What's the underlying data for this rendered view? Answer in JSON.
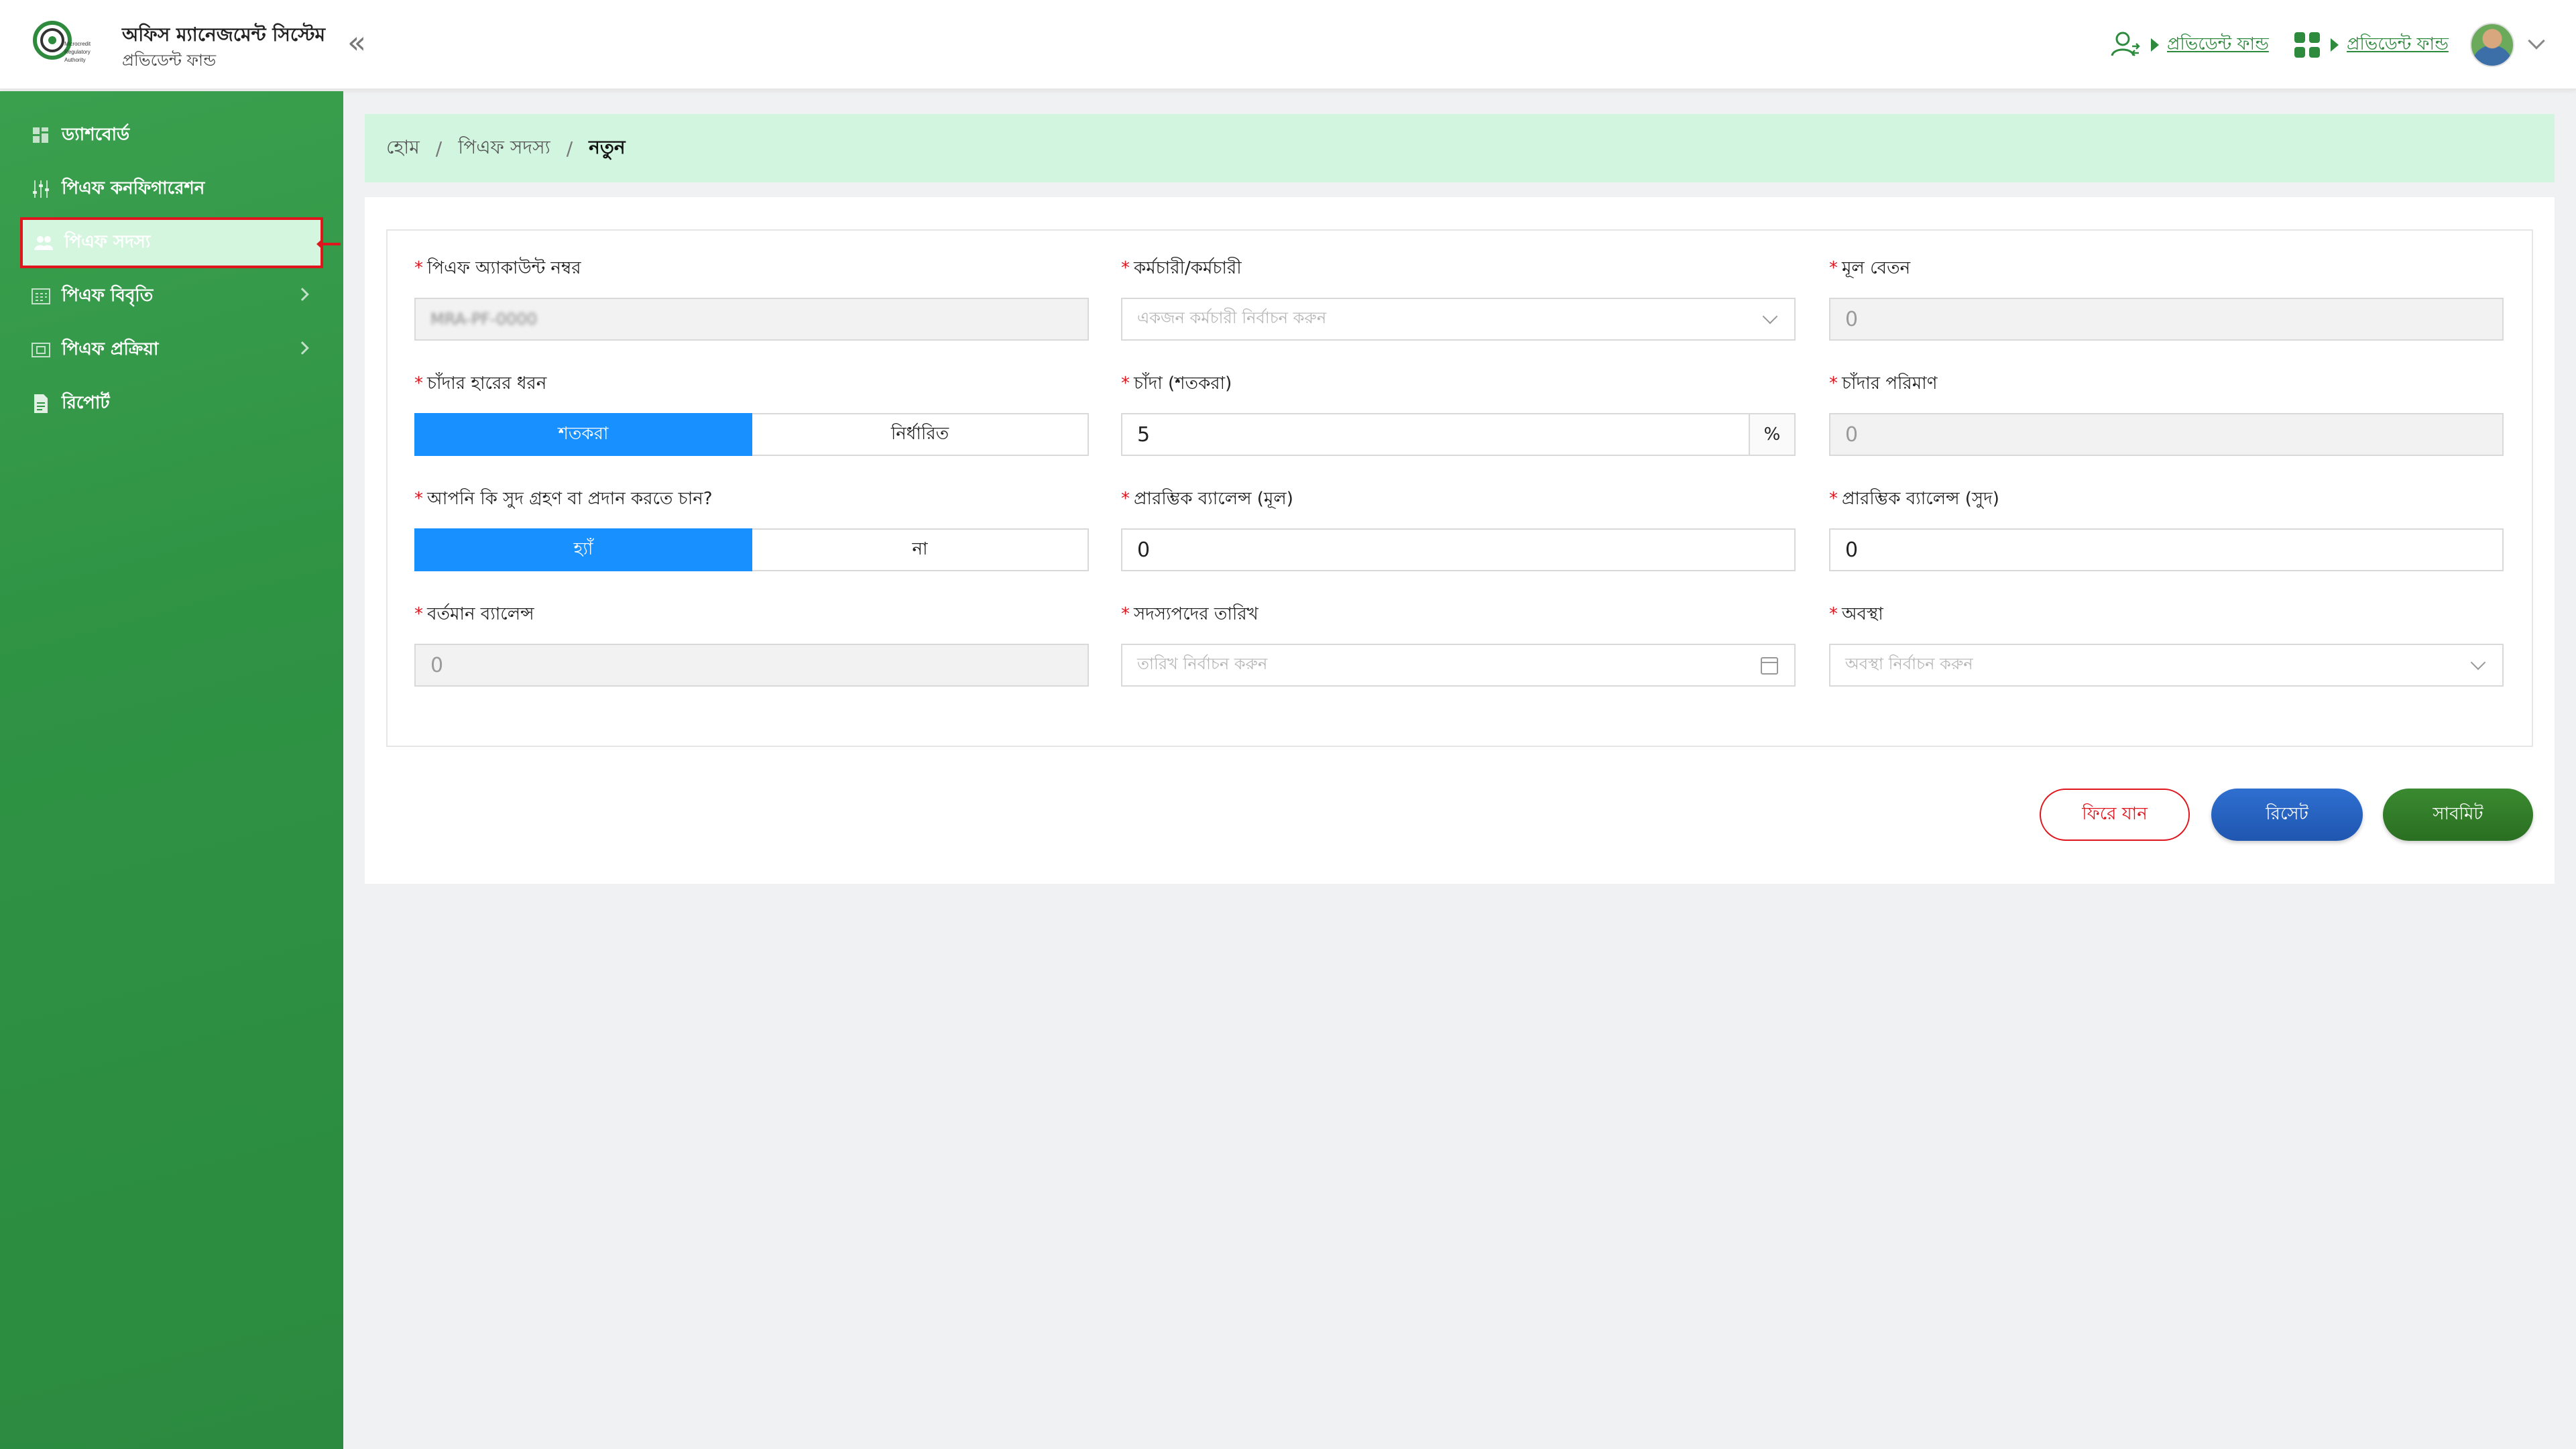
{
  "header": {
    "app_title": "অফিস ম্যানেজমেন্ট সিস্টেম",
    "app_subtitle": "প্রভিডেন্ট ফান্ড",
    "link_1": "প্রভিডেন্ট ফান্ড",
    "link_2": "প্রভিডেন্ট ফান্ড",
    "logo_text": "Microcredit Regulatory Authority"
  },
  "sidebar": {
    "items": [
      {
        "label": "ড্যাশবোর্ড",
        "icon": "dashboard-icon"
      },
      {
        "label": "পিএফ কনফিগারেশন",
        "icon": "config-sliders-icon"
      },
      {
        "label": "পিএফ সদস্য",
        "icon": "members-icon",
        "active": true
      },
      {
        "label": "পিএফ বিবৃতি",
        "icon": "statement-icon",
        "has_submenu": true
      },
      {
        "label": "পিএফ প্রক্রিয়া",
        "icon": "process-icon",
        "has_submenu": true
      },
      {
        "label": "রিপোর্ট",
        "icon": "report-icon"
      }
    ]
  },
  "breadcrumb": {
    "home": "হোম",
    "section": "পিএফ সদস্য",
    "current": "নতুন",
    "separator": "/"
  },
  "form": {
    "account_no": {
      "label": "পিএফ অ্যাকাউন্ট নম্বর",
      "value": "MRA-PF-0000"
    },
    "employee": {
      "label": "কর্মচারী/কর্মচারী",
      "placeholder": "একজন কর্মচারী নির্বাচন করুন"
    },
    "basic_salary": {
      "label": "মূল বেতন",
      "value": "0"
    },
    "contribution_type": {
      "label": "চাঁদার হারের ধরন",
      "options": [
        "শতকরা",
        "নির্ধারিত"
      ],
      "selected": "শতকরা"
    },
    "contribution_percent": {
      "label": "চাঁদা (শতকরা)",
      "value": "5",
      "suffix": "%"
    },
    "contribution_amount": {
      "label": "চাঁদার পরিমাণ",
      "value": "0"
    },
    "interest": {
      "label": "আপনি কি সুদ গ্রহণ বা প্রদান করতে চান?",
      "options": [
        "হ্যাঁ",
        "না"
      ],
      "selected": "হ্যাঁ"
    },
    "opening_principal": {
      "label": "প্রারম্ভিক ব্যালেন্স (মূল)",
      "value": "0"
    },
    "opening_interest": {
      "label": "প্রারম্ভিক ব্যালেন্স (সুদ)",
      "value": "0"
    },
    "current_balance": {
      "label": "বর্তমান ব্যালেন্স",
      "value": "0"
    },
    "membership_date": {
      "label": "সদস্যপদের তারিখ",
      "placeholder": "তারিখ নির্বাচন করুন"
    },
    "status": {
      "label": "অবস্থা",
      "placeholder": "অবস্থা নির্বাচন করুন"
    }
  },
  "buttons": {
    "back": "ফিরে যান",
    "reset": "রিসেট",
    "submit": "সাবমিট"
  },
  "colors": {
    "sidebar_green": "#2f9344",
    "breadcrumb_bg": "#d2f5e0",
    "primary_blue": "#1890ff",
    "required_red": "#e0151d",
    "link_green": "#2e8b3d"
  }
}
